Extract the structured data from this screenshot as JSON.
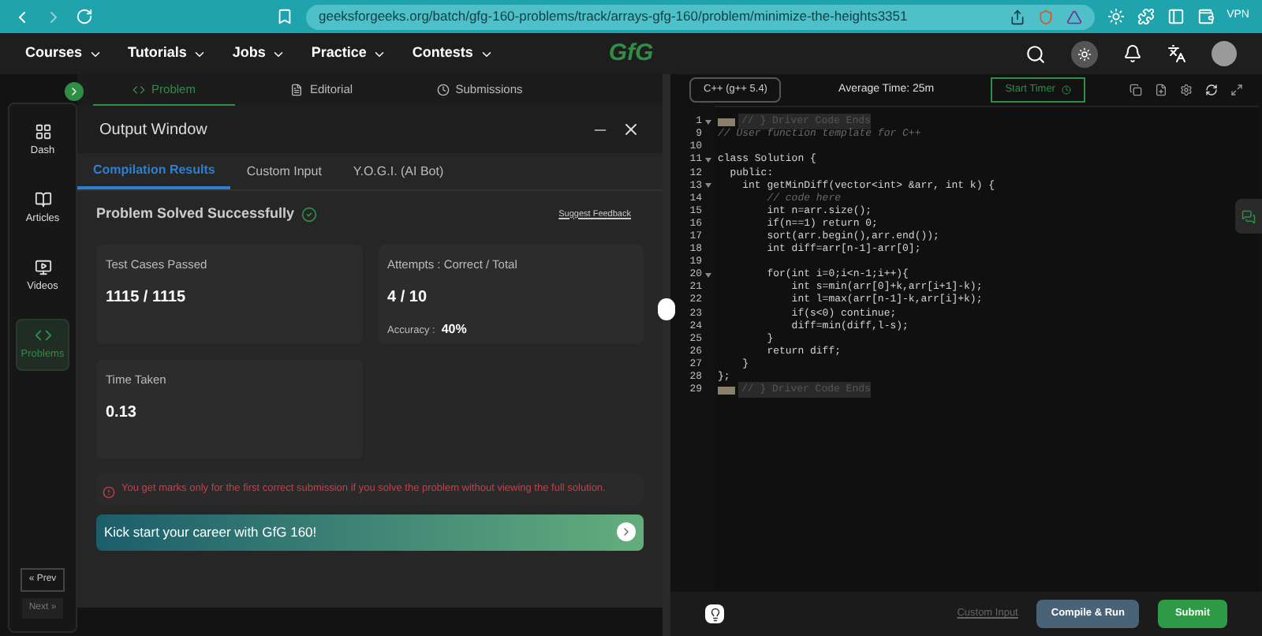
{
  "browser": {
    "url": "geeksforgeeks.org/batch/gfg-160-problems/track/arrays-gfg-160/problem/minimize-the-heights3351",
    "vpn_label": "VPN"
  },
  "nav": {
    "items": [
      "Courses",
      "Tutorials",
      "Jobs",
      "Practice",
      "Contests"
    ],
    "logo": "GfG"
  },
  "sidebar": {
    "items": [
      {
        "label": "Dash",
        "kind": "dash",
        "selected": false
      },
      {
        "label": "Articles",
        "kind": "articles",
        "selected": false
      },
      {
        "label": "Videos",
        "kind": "videos",
        "selected": false
      },
      {
        "label": "Problems",
        "kind": "problems",
        "selected": true
      }
    ],
    "prev": "« Prev",
    "next": "Next »"
  },
  "problem_tabs": [
    {
      "label": "Problem",
      "kind": "code",
      "selected": true
    },
    {
      "label": "Editorial",
      "kind": "doc",
      "selected": false
    },
    {
      "label": "Submissions",
      "kind": "clock",
      "selected": false
    }
  ],
  "output_window": {
    "title": "Output Window",
    "tabs": [
      {
        "label": "Compilation Results",
        "selected": true
      },
      {
        "label": "Custom Input",
        "selected": false
      },
      {
        "label": "Y.O.G.I. (AI Bot)",
        "selected": false
      }
    ],
    "status": "Problem Solved Successfully",
    "feedback_link": "Suggest Feedback",
    "cards": [
      {
        "label": "Test Cases Passed",
        "value": "1115 / 1115"
      },
      {
        "label": "Attempts : Correct / Total",
        "value": "4 / 10",
        "extra_label": "Accuracy :",
        "extra_value": "40%"
      },
      {
        "label": "Time Taken",
        "value": "0.13"
      }
    ],
    "notice": "You get marks only for the first correct submission if you solve the problem without viewing the full solution.",
    "banner": "Kick start your career with GfG 160!"
  },
  "editor": {
    "language": "C++ (g++ 5.4)",
    "average_time": "Average Time: 25m",
    "timer_button": "Start Timer",
    "lines": [
      {
        "number": "1",
        "text": "// } Driver Code Ends",
        "kind": "folded",
        "foldable": true
      },
      {
        "number": "9",
        "text": "// User function template for C++",
        "kind": "comment",
        "foldable": false
      },
      {
        "number": "10",
        "kind": "code",
        "foldable": false
      },
      {
        "number": "11",
        "text": "class Solution {",
        "kind": "code",
        "foldable": true
      },
      {
        "number": "12",
        "text": "  public:",
        "kind": "code",
        "foldable": false
      },
      {
        "number": "13",
        "text": "    int getMinDiff(vector<int> &arr, int k) {",
        "kind": "code",
        "foldable": true
      },
      {
        "number": "14",
        "text": "        // code here",
        "kind": "comment",
        "foldable": false
      },
      {
        "number": "15",
        "text": "        int n=arr.size();",
        "kind": "code",
        "foldable": false
      },
      {
        "number": "16",
        "text": "        if(n==1) return 0;",
        "kind": "code",
        "foldable": false
      },
      {
        "number": "17",
        "text": "        sort(arr.begin(),arr.end());",
        "kind": "code",
        "foldable": false
      },
      {
        "number": "18",
        "text": "        int diff=arr[n-1]-arr[0];",
        "kind": "code",
        "foldable": false
      },
      {
        "number": "19",
        "kind": "code",
        "foldable": false
      },
      {
        "number": "20",
        "text": "        for(int i=0;i<n-1;i++){",
        "kind": "code",
        "foldable": true
      },
      {
        "number": "21",
        "text": "            int s=min(arr[0]+k,arr[i+1]-k);",
        "kind": "code",
        "foldable": false
      },
      {
        "number": "22",
        "text": "            int l=max(arr[n-1]-k,arr[i]+k);",
        "kind": "code",
        "foldable": false
      },
      {
        "number": "23",
        "text": "            if(s<0) continue;",
        "kind": "code",
        "foldable": false
      },
      {
        "number": "24",
        "text": "            diff=min(diff,l-s);",
        "kind": "code",
        "foldable": false
      },
      {
        "number": "25",
        "text": "        }",
        "kind": "code",
        "foldable": false
      },
      {
        "number": "26",
        "text": "        return diff;",
        "kind": "code",
        "foldable": false
      },
      {
        "number": "27",
        "text": "    }",
        "kind": "code",
        "foldable": false
      },
      {
        "number": "28",
        "text": "};",
        "kind": "code",
        "foldable": false
      },
      {
        "number": "29",
        "text": "// } Driver Code Ends",
        "kind": "folded",
        "foldable": false
      }
    ],
    "custom_input": "Custom Input",
    "compile_button": "Compile & Run",
    "submit_button": "Submit"
  }
}
